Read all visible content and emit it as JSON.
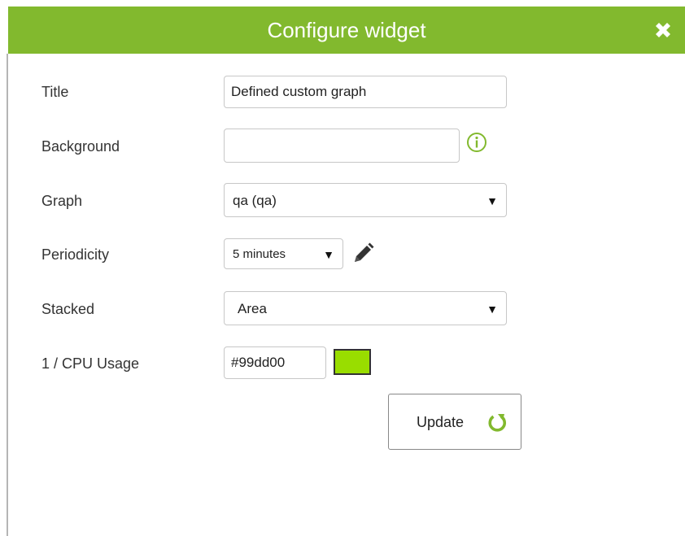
{
  "dialog": {
    "title": "Configure widget",
    "close_icon": "close-icon"
  },
  "form": {
    "title": {
      "label": "Title",
      "value": "Defined custom graph",
      "placeholder": ""
    },
    "background": {
      "label": "Background",
      "value": "",
      "info_icon": "info-icon"
    },
    "graph": {
      "label": "Graph",
      "value": "qa (qa)"
    },
    "periodicity": {
      "label": "Periodicity",
      "value": "5 minutes",
      "edit_icon": "pencil-icon"
    },
    "stacked": {
      "label": "Stacked",
      "value": "Area"
    },
    "series_color": {
      "label": "1 / CPU Usage",
      "value": "#99dd00",
      "swatch_color": "#99dd00"
    }
  },
  "actions": {
    "update_label": "Update",
    "update_icon": "refresh-icon"
  },
  "colors": {
    "header": "#82b92e",
    "accent": "#82b92e"
  }
}
